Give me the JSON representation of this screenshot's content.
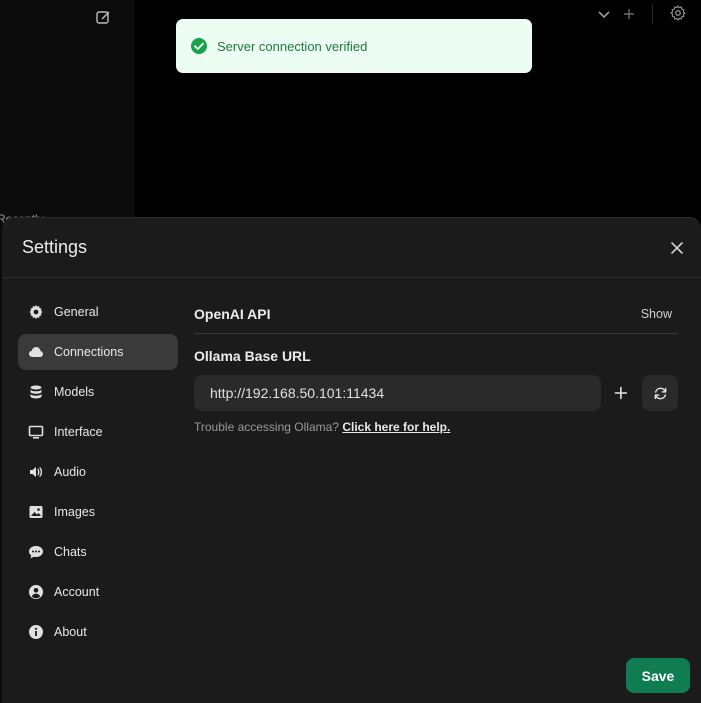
{
  "background": {
    "recent_label": "Recently"
  },
  "toast": {
    "message": "Server connection verified",
    "color": "#16a34a"
  },
  "modal": {
    "title": "Settings",
    "nav": [
      {
        "label": "General",
        "icon": "gear-icon"
      },
      {
        "label": "Connections",
        "icon": "cloud-icon",
        "active": true
      },
      {
        "label": "Models",
        "icon": "database-icon"
      },
      {
        "label": "Interface",
        "icon": "monitor-icon"
      },
      {
        "label": "Audio",
        "icon": "speaker-icon"
      },
      {
        "label": "Images",
        "icon": "image-icon"
      },
      {
        "label": "Chats",
        "icon": "chat-bubble-icon"
      },
      {
        "label": "Account",
        "icon": "user-circle-icon"
      },
      {
        "label": "About",
        "icon": "info-icon"
      }
    ],
    "openai": {
      "title": "OpenAI API",
      "toggle_label": "Show"
    },
    "ollama": {
      "label": "Ollama Base URL",
      "url_value": "http://192.168.50.101:11434",
      "hint_text": "Trouble accessing Ollama?",
      "hint_link": "Click here for help."
    },
    "save_label": "Save",
    "accent_color": "#107c52"
  }
}
